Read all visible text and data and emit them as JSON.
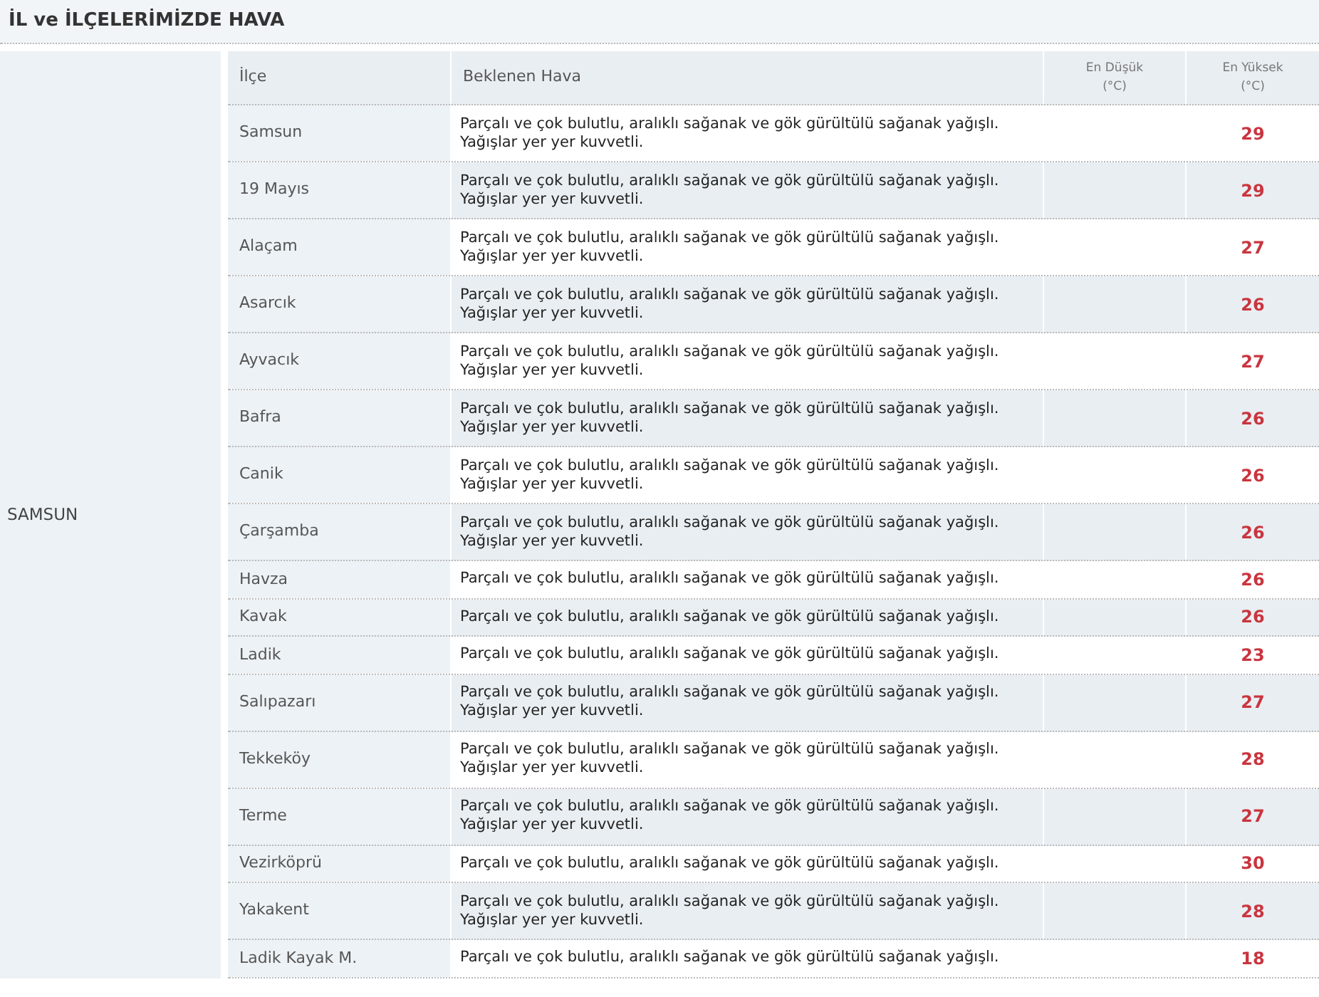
{
  "title": "İL ve İLÇELERİMİZDE HAVA",
  "province": "SAMSUN",
  "columns": [
    {
      "lines": [
        "İlçe"
      ],
      "kind": "left"
    },
    {
      "lines": [
        "Beklenen Hava"
      ],
      "kind": "left"
    },
    {
      "lines": [
        "En Düşük",
        "(°C)"
      ],
      "kind": "small"
    },
    {
      "lines": [
        "En Yüksek",
        "(°C)"
      ],
      "kind": "small"
    }
  ],
  "rows": [
    {
      "district": "Samsun",
      "weather": [
        "Parçalı ve çok bulutlu, aralıklı sağanak ve gök gürültülü sağanak yağışlı.",
        "Yağışlar yer yer kuvvetli."
      ],
      "high": "29"
    },
    {
      "district": "19 Mayıs",
      "weather": [
        "Parçalı ve çok bulutlu, aralıklı sağanak ve gök gürültülü sağanak yağışlı.",
        "Yağışlar yer yer kuvvetli."
      ],
      "high": "29"
    },
    {
      "district": "Alaçam",
      "weather": [
        "Parçalı ve çok bulutlu, aralıklı sağanak ve gök gürültülü sağanak yağışlı.",
        "Yağışlar yer yer kuvvetli."
      ],
      "high": "27"
    },
    {
      "district": "Asarcık",
      "weather": [
        "Parçalı ve çok bulutlu, aralıklı sağanak ve gök gürültülü sağanak yağışlı.",
        "Yağışlar yer yer kuvvetli."
      ],
      "high": "26"
    },
    {
      "district": "Ayvacık",
      "weather": [
        "Parçalı ve çok bulutlu, aralıklı sağanak ve gök gürültülü sağanak yağışlı.",
        "Yağışlar yer yer kuvvetli."
      ],
      "high": "27"
    },
    {
      "district": "Bafra",
      "weather": [
        "Parçalı ve çok bulutlu, aralıklı sağanak ve gök gürültülü sağanak yağışlı.",
        "Yağışlar yer yer kuvvetli."
      ],
      "high": "26"
    },
    {
      "district": "Canik",
      "weather": [
        "Parçalı ve çok bulutlu, aralıklı sağanak ve gök gürültülü sağanak yağışlı.",
        "Yağışlar yer yer kuvvetli."
      ],
      "high": "26"
    },
    {
      "district": "Çarşamba",
      "weather": [
        "Parçalı ve çok bulutlu, aralıklı sağanak ve gök gürültülü sağanak yağışlı.",
        "Yağışlar yer yer kuvvetli."
      ],
      "high": "26"
    },
    {
      "district": "Havza",
      "weather": [
        "Parçalı ve çok bulutlu, aralıklı sağanak ve gök gürültülü sağanak yağışlı."
      ],
      "high": "26"
    },
    {
      "district": "Kavak",
      "weather": [
        "Parçalı ve çok bulutlu, aralıklı sağanak ve gök gürültülü sağanak yağışlı."
      ],
      "high": "26"
    },
    {
      "district": "Ladik",
      "weather": [
        "Parçalı ve çok bulutlu, aralıklı sağanak ve gök gürültülü sağanak yağışlı."
      ],
      "high": "23"
    },
    {
      "district": "Salıpazarı",
      "weather": [
        "Parçalı ve çok bulutlu, aralıklı sağanak ve gök gürültülü sağanak yağışlı.",
        "Yağışlar yer yer kuvvetli."
      ],
      "high": "27"
    },
    {
      "district": "Tekkeköy",
      "weather": [
        "Parçalı ve çok bulutlu, aralıklı sağanak ve gök gürültülü sağanak yağışlı.",
        "Yağışlar yer yer kuvvetli."
      ],
      "high": "28"
    },
    {
      "district": "Terme",
      "weather": [
        "Parçalı ve çok bulutlu, aralıklı sağanak ve gök gürültülü sağanak yağışlı.",
        "Yağışlar yer yer kuvvetli."
      ],
      "high": "27"
    },
    {
      "district": "Vezirköprü",
      "weather": [
        "Parçalı ve çok bulutlu, aralıklı sağanak ve gök gürültülü sağanak yağışlı."
      ],
      "high": "30"
    },
    {
      "district": "Yakakent",
      "weather": [
        "Parçalı ve çok bulutlu, aralıklı sağanak ve gök gürültülü sağanak yağışlı.",
        "Yağışlar yer yer kuvvetli."
      ],
      "high": "28"
    },
    {
      "district": "Ladik Kayak M.",
      "weather": [
        "Parçalı ve çok bulutlu, aralıklı sağanak ve gök gürültülü sağanak yağışlı."
      ],
      "high": "18"
    }
  ]
}
